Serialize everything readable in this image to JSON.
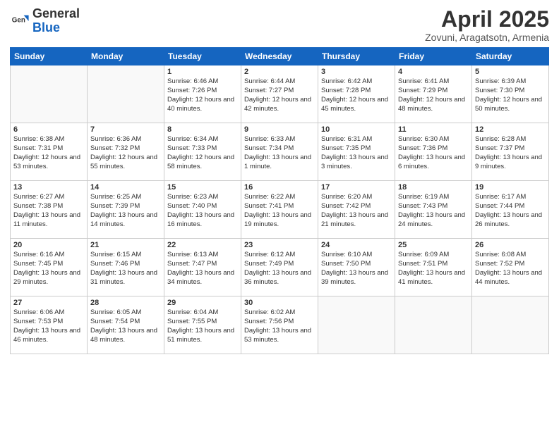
{
  "header": {
    "logo_general": "General",
    "logo_blue": "Blue",
    "month_title": "April 2025",
    "location": "Zovuni, Aragatsotn, Armenia"
  },
  "weekdays": [
    "Sunday",
    "Monday",
    "Tuesday",
    "Wednesday",
    "Thursday",
    "Friday",
    "Saturday"
  ],
  "weeks": [
    [
      {
        "day": "",
        "info": ""
      },
      {
        "day": "",
        "info": ""
      },
      {
        "day": "1",
        "info": "Sunrise: 6:46 AM\nSunset: 7:26 PM\nDaylight: 12 hours and 40 minutes."
      },
      {
        "day": "2",
        "info": "Sunrise: 6:44 AM\nSunset: 7:27 PM\nDaylight: 12 hours and 42 minutes."
      },
      {
        "day": "3",
        "info": "Sunrise: 6:42 AM\nSunset: 7:28 PM\nDaylight: 12 hours and 45 minutes."
      },
      {
        "day": "4",
        "info": "Sunrise: 6:41 AM\nSunset: 7:29 PM\nDaylight: 12 hours and 48 minutes."
      },
      {
        "day": "5",
        "info": "Sunrise: 6:39 AM\nSunset: 7:30 PM\nDaylight: 12 hours and 50 minutes."
      }
    ],
    [
      {
        "day": "6",
        "info": "Sunrise: 6:38 AM\nSunset: 7:31 PM\nDaylight: 12 hours and 53 minutes."
      },
      {
        "day": "7",
        "info": "Sunrise: 6:36 AM\nSunset: 7:32 PM\nDaylight: 12 hours and 55 minutes."
      },
      {
        "day": "8",
        "info": "Sunrise: 6:34 AM\nSunset: 7:33 PM\nDaylight: 12 hours and 58 minutes."
      },
      {
        "day": "9",
        "info": "Sunrise: 6:33 AM\nSunset: 7:34 PM\nDaylight: 13 hours and 1 minute."
      },
      {
        "day": "10",
        "info": "Sunrise: 6:31 AM\nSunset: 7:35 PM\nDaylight: 13 hours and 3 minutes."
      },
      {
        "day": "11",
        "info": "Sunrise: 6:30 AM\nSunset: 7:36 PM\nDaylight: 13 hours and 6 minutes."
      },
      {
        "day": "12",
        "info": "Sunrise: 6:28 AM\nSunset: 7:37 PM\nDaylight: 13 hours and 9 minutes."
      }
    ],
    [
      {
        "day": "13",
        "info": "Sunrise: 6:27 AM\nSunset: 7:38 PM\nDaylight: 13 hours and 11 minutes."
      },
      {
        "day": "14",
        "info": "Sunrise: 6:25 AM\nSunset: 7:39 PM\nDaylight: 13 hours and 14 minutes."
      },
      {
        "day": "15",
        "info": "Sunrise: 6:23 AM\nSunset: 7:40 PM\nDaylight: 13 hours and 16 minutes."
      },
      {
        "day": "16",
        "info": "Sunrise: 6:22 AM\nSunset: 7:41 PM\nDaylight: 13 hours and 19 minutes."
      },
      {
        "day": "17",
        "info": "Sunrise: 6:20 AM\nSunset: 7:42 PM\nDaylight: 13 hours and 21 minutes."
      },
      {
        "day": "18",
        "info": "Sunrise: 6:19 AM\nSunset: 7:43 PM\nDaylight: 13 hours and 24 minutes."
      },
      {
        "day": "19",
        "info": "Sunrise: 6:17 AM\nSunset: 7:44 PM\nDaylight: 13 hours and 26 minutes."
      }
    ],
    [
      {
        "day": "20",
        "info": "Sunrise: 6:16 AM\nSunset: 7:45 PM\nDaylight: 13 hours and 29 minutes."
      },
      {
        "day": "21",
        "info": "Sunrise: 6:15 AM\nSunset: 7:46 PM\nDaylight: 13 hours and 31 minutes."
      },
      {
        "day": "22",
        "info": "Sunrise: 6:13 AM\nSunset: 7:47 PM\nDaylight: 13 hours and 34 minutes."
      },
      {
        "day": "23",
        "info": "Sunrise: 6:12 AM\nSunset: 7:49 PM\nDaylight: 13 hours and 36 minutes."
      },
      {
        "day": "24",
        "info": "Sunrise: 6:10 AM\nSunset: 7:50 PM\nDaylight: 13 hours and 39 minutes."
      },
      {
        "day": "25",
        "info": "Sunrise: 6:09 AM\nSunset: 7:51 PM\nDaylight: 13 hours and 41 minutes."
      },
      {
        "day": "26",
        "info": "Sunrise: 6:08 AM\nSunset: 7:52 PM\nDaylight: 13 hours and 44 minutes."
      }
    ],
    [
      {
        "day": "27",
        "info": "Sunrise: 6:06 AM\nSunset: 7:53 PM\nDaylight: 13 hours and 46 minutes."
      },
      {
        "day": "28",
        "info": "Sunrise: 6:05 AM\nSunset: 7:54 PM\nDaylight: 13 hours and 48 minutes."
      },
      {
        "day": "29",
        "info": "Sunrise: 6:04 AM\nSunset: 7:55 PM\nDaylight: 13 hours and 51 minutes."
      },
      {
        "day": "30",
        "info": "Sunrise: 6:02 AM\nSunset: 7:56 PM\nDaylight: 13 hours and 53 minutes."
      },
      {
        "day": "",
        "info": ""
      },
      {
        "day": "",
        "info": ""
      },
      {
        "day": "",
        "info": ""
      }
    ]
  ]
}
